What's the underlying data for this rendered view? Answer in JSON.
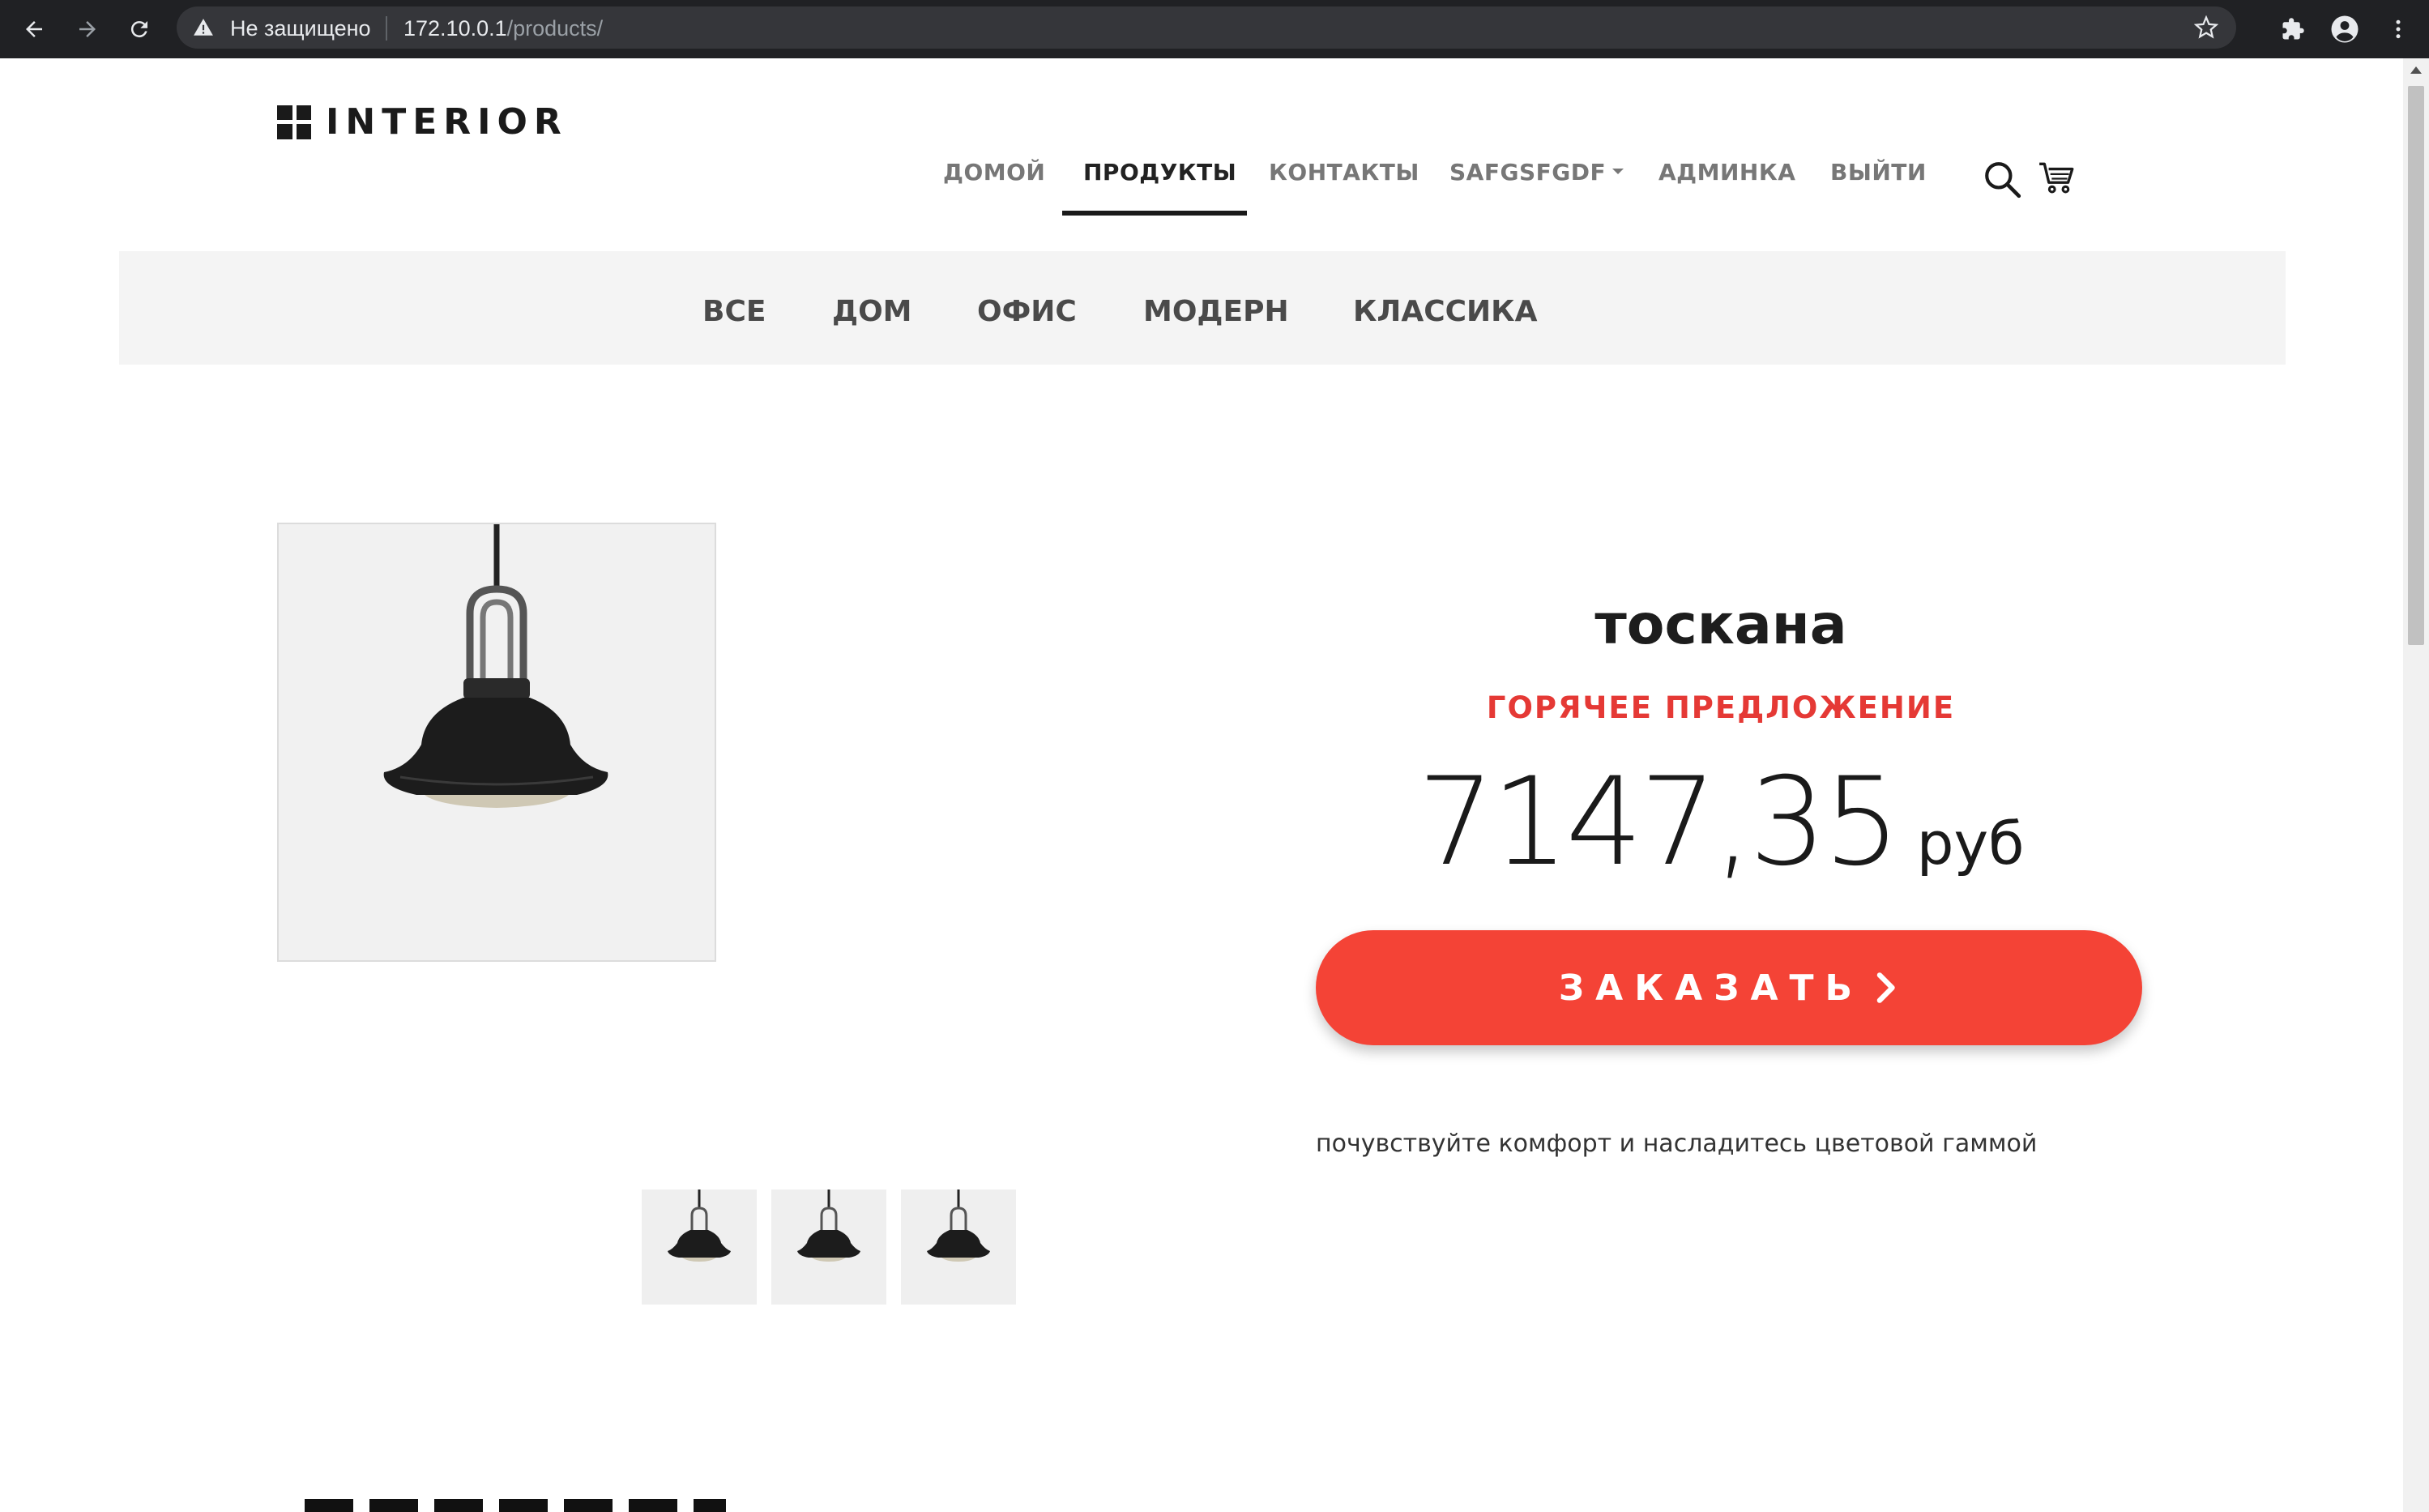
{
  "browser": {
    "security_label": "Не защищено",
    "url_host": "172.10.0.1",
    "url_path": "/products/"
  },
  "site": {
    "logo_text": "INTERIOR"
  },
  "topnav": {
    "items": [
      {
        "label": "ДОМОЙ"
      },
      {
        "label": "ПРОДУКТЫ",
        "active": true
      },
      {
        "label": "КОНТАКТЫ"
      },
      {
        "label": "SAFGSFGDF"
      },
      {
        "label": "АДМИНКА"
      },
      {
        "label": "ВЫЙТИ"
      }
    ]
  },
  "categories": [
    {
      "label": "ВСЕ"
    },
    {
      "label": "ДОМ"
    },
    {
      "label": "ОФИС"
    },
    {
      "label": "МОДЕРН"
    },
    {
      "label": "КЛАССИКА"
    }
  ],
  "product": {
    "title": "тоскана",
    "offer": "ГОРЯЧЕЕ ПРЕДЛОЖЕНИЕ",
    "price": "7147,35",
    "currency": "руб",
    "order_button": "ЗАКАЗАТЬ",
    "description": "почувствуйте комфорт и насладитесь цветовой гаммой"
  },
  "colors": {
    "accent": "#f44336",
    "offer": "#e53935",
    "chrome_bg": "#202124"
  }
}
